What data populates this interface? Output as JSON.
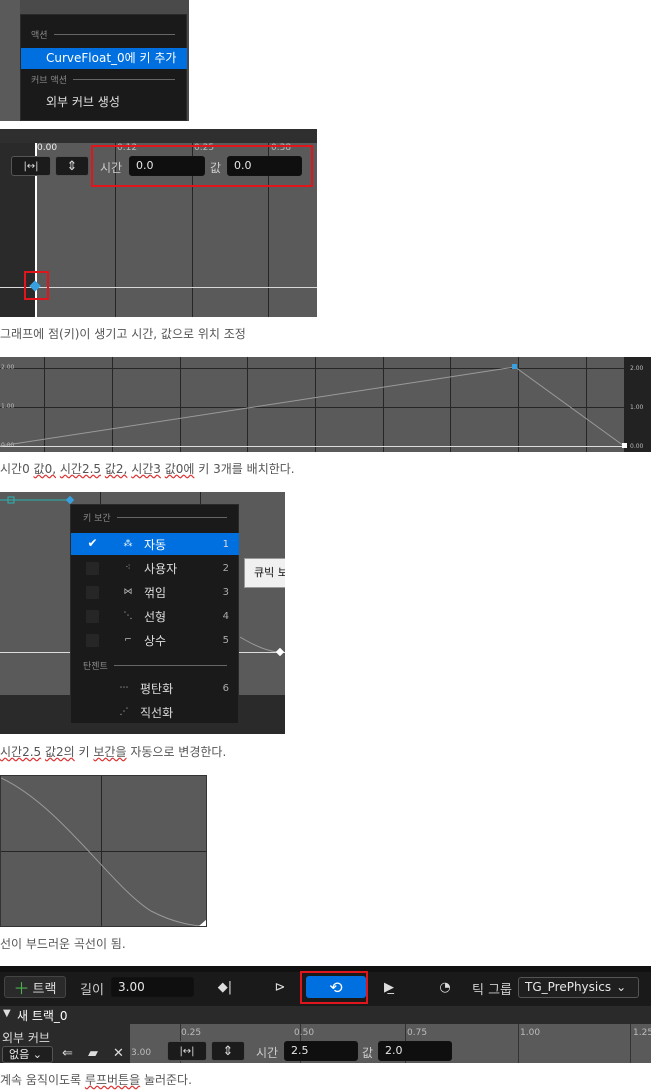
{
  "section1": {
    "header_actions": "액션",
    "item_add_key": "CurveFloat_0에 키 추가",
    "header_curve_actions": "커브 액션",
    "item_create_external": "외부 커브 생성"
  },
  "section2": {
    "ticks": [
      "0.00",
      "0.12",
      "0.25",
      "0.38"
    ],
    "time_label": "시간",
    "time_value": "0.0",
    "value_label": "값",
    "value_value": "0.0",
    "caption": "그래프에 점(키)이 생기고 시간, 값으로 위치 조정"
  },
  "section3": {
    "y_ticks": [
      "2.00",
      "1.00",
      "0.00"
    ],
    "right_ticks": [
      "2.00",
      "1.00",
      "0.00"
    ],
    "caption_a": "시간0 ",
    "caption_b": "값0,",
    "caption_c": " ",
    "caption_d": "시간2.5",
    "caption_e": " ",
    "caption_f": "값2,",
    "caption_g": " ",
    "caption_h": "시간3",
    "caption_i": " ",
    "caption_j": "값0에",
    "caption_k": " 키 3개를 배치한다."
  },
  "section4": {
    "header_interp": "키 보간",
    "items": [
      {
        "label": "자동",
        "key": "1",
        "checked": true,
        "icon": "auto-interp-icon"
      },
      {
        "label": "사용자",
        "key": "2",
        "checked": false,
        "icon": "user-interp-icon"
      },
      {
        "label": "꺾임",
        "key": "3",
        "checked": false,
        "icon": "break-interp-icon"
      },
      {
        "label": "선형",
        "key": "4",
        "checked": false,
        "icon": "linear-interp-icon"
      },
      {
        "label": "상수",
        "key": "5",
        "checked": false,
        "icon": "constant-interp-icon"
      }
    ],
    "header_tangent": "탄젠트",
    "tangent_items": [
      {
        "label": "평탄화",
        "key": "6",
        "icon": "flatten-icon"
      },
      {
        "label": "직선화",
        "key": "",
        "icon": "straighten-icon"
      }
    ],
    "tooltip": "큐빅 보",
    "caption_a": "시간2.5",
    "caption_b": " ",
    "caption_c": "값2의",
    "caption_d": " 키 ",
    "caption_e": "보간을",
    "caption_f": " 자동으로 변경한다."
  },
  "section5": {
    "caption": "선이 부드러운 곡선이 됨."
  },
  "section6": {
    "add_track": "트랙",
    "length_label": "길이",
    "length_value": "3.00",
    "tick_group_label": "틱 그룹",
    "tick_group_value": "TG_PrePhysics",
    "new_track": "새 트랙_0",
    "external_curve": "외부 커브",
    "none_option": "없음",
    "ticks": [
      "0.25",
      "0.50",
      "0.75",
      "1.00",
      "1.25"
    ],
    "tick_left": "3.00",
    "time_label": "시간",
    "time_value": "2.5",
    "value_label": "값",
    "value_value": "2.0",
    "caption_a": "계속 움직이도록 ",
    "caption_b": "루프버튼을",
    "caption_c": " 눌러준다."
  },
  "colors": {
    "accent_blue": "#0070e0",
    "highlight_red": "#e0161c",
    "panel_dark": "#1a1a1a",
    "graph_gray": "#5a5a5a"
  }
}
